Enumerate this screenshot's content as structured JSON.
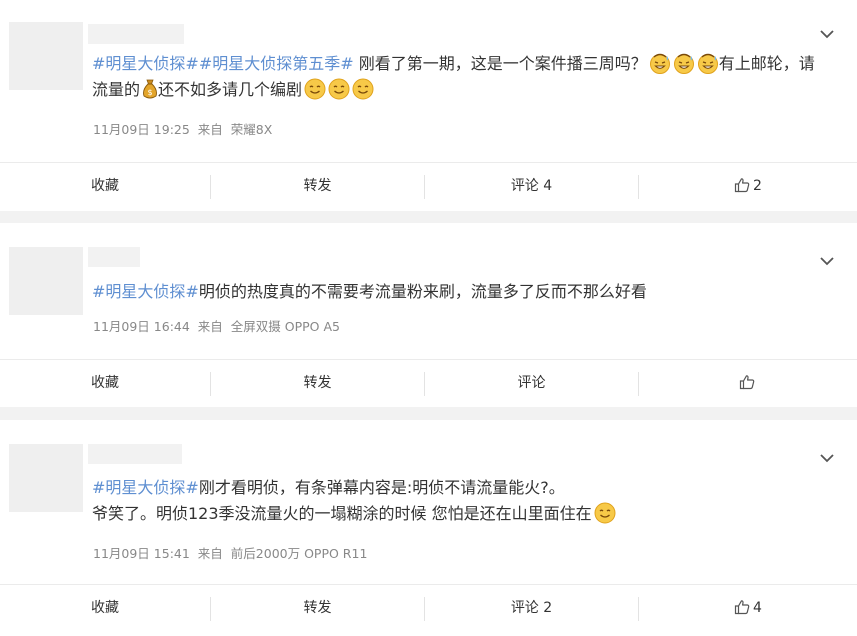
{
  "posts": [
    {
      "text_segments": [
        {
          "type": "tag",
          "text": "#明星大侦探##明星大侦探第五季#"
        },
        {
          "type": "text",
          "text": " 刚看了第一期，这是一个案件播三周吗？"
        },
        {
          "type": "emoji",
          "name": "grin-sweat-emoji"
        },
        {
          "type": "emoji",
          "name": "grin-sweat-emoji"
        },
        {
          "type": "emoji",
          "name": "grin-sweat-emoji"
        },
        {
          "type": "text",
          "text": "有上邮轮，请流量的"
        },
        {
          "type": "emoji",
          "name": "money-bag-emoji"
        },
        {
          "type": "text",
          "text": "还不如多请几个编剧"
        },
        {
          "type": "emoji",
          "name": "smile-emoji"
        },
        {
          "type": "emoji",
          "name": "smile-emoji"
        },
        {
          "type": "emoji",
          "name": "smile-emoji"
        }
      ],
      "date": "11月09日 19:25",
      "source_prefix": "来自",
      "source": "荣耀8X",
      "actions": {
        "favorite": "收藏",
        "repost": "转发",
        "comment": "评论 4",
        "like_count": "2"
      }
    },
    {
      "text_segments": [
        {
          "type": "tag",
          "text": "#明星大侦探#"
        },
        {
          "type": "text",
          "text": "明侦的热度真的不需要考流量粉来刷，流量多了反而不那么好看"
        }
      ],
      "date": "11月09日 16:44",
      "source_prefix": "来自",
      "source": "全屏双摄 OPPO A5",
      "actions": {
        "favorite": "收藏",
        "repost": "转发",
        "comment": "评论",
        "like_count": ""
      }
    },
    {
      "text_segments": [
        {
          "type": "tag",
          "text": "#明星大侦探#"
        },
        {
          "type": "text",
          "text": "刚才看明侦，有条弹幕内容是:明侦不请流量能火?。"
        },
        {
          "type": "break"
        },
        {
          "type": "text",
          "text": "爷笑了。明侦123季没流量火的一塌糊涂的时候 您怕是还在山里面住在"
        },
        {
          "type": "emoji",
          "name": "smile-emoji"
        }
      ],
      "date": "11月09日 15:41",
      "source_prefix": "来自",
      "source": "前后2000万 OPPO R11",
      "actions": {
        "favorite": "收藏",
        "repost": "转发",
        "comment": "评论 2",
        "like_count": "4"
      }
    }
  ],
  "icons": {
    "expand": "chevron-down-icon",
    "like": "thumbs-up-icon"
  },
  "colors": {
    "topic_link": "#5f8fd1",
    "meta_text": "#888888",
    "page_bg": "#f2f2f2"
  }
}
